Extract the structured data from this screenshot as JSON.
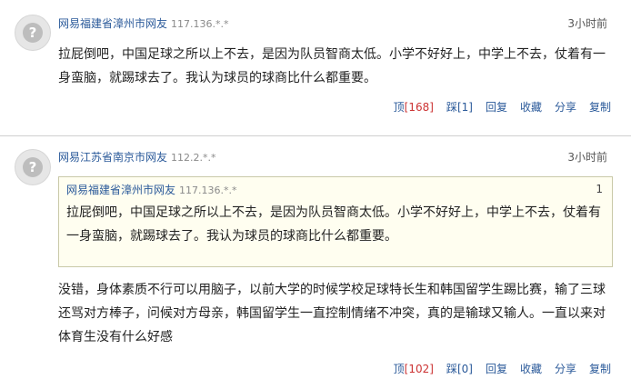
{
  "comments": [
    {
      "user": "网易福建省漳州市网友",
      "ip": "117.136.*.*",
      "time": "3小时前",
      "text": "拉屁倒吧，中国足球之所以上不去，是因为队员智商太低。小学不好好上，中学上不去，仗着有一身蛮脑，就踢球去了。我认为球员的球商比什么都重要。",
      "actions": {
        "up_label": "顶",
        "up_count": "[168]",
        "down_label": "踩",
        "down_count": "[1]",
        "reply": "回复",
        "favorite": "收藏",
        "share": "分享",
        "copy": "复制"
      }
    },
    {
      "user": "网易江苏省南京市网友",
      "ip": "112.2.*.*",
      "time": "3小时前",
      "quote": {
        "user": "网易福建省漳州市网友",
        "ip": "117.136.*.*",
        "floor": "1",
        "text": "拉屁倒吧，中国足球之所以上不去，是因为队员智商太低。小学不好好上，中学上不去，仗着有一身蛮脑，就踢球去了。我认为球员的球商比什么都重要。"
      },
      "text": "没错，身体素质不行可以用脑子，以前大学的时候学校足球特长生和韩国留学生踢比赛，输了三球还骂对方棒子，问候对方母亲，韩国留学生一直控制情绪不冲突，真的是输球又输人。一直以来对体育生没有什么好感",
      "actions": {
        "up_label": "顶",
        "up_count": "[102]",
        "down_label": "踩",
        "down_count": "[0]",
        "reply": "回复",
        "favorite": "收藏",
        "share": "分享",
        "copy": "复制"
      }
    }
  ]
}
